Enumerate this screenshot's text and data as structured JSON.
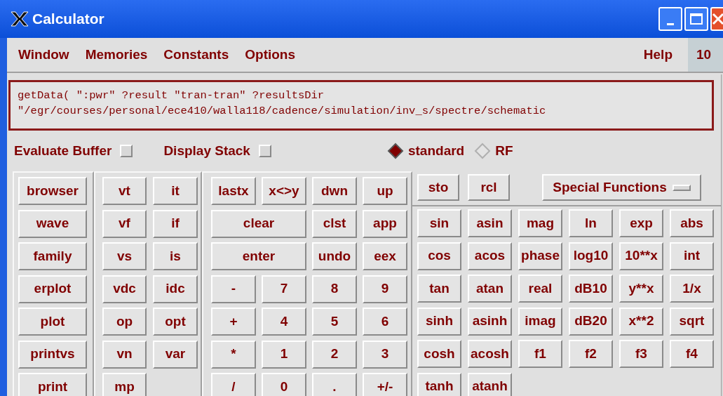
{
  "window": {
    "title": "Calculator"
  },
  "menu": {
    "items": [
      "Window",
      "Memories",
      "Constants",
      "Options"
    ],
    "help": "Help",
    "tab": "10"
  },
  "display": {
    "lines": [
      "getData( \":pwr\" ?result \"tran-tran\" ?resultsDir",
      "\"/egr/courses/personal/ece410/walla118/cadence/simulation/inv_s/spectre/schematic"
    ]
  },
  "checkboxes": [
    {
      "label": "Evaluate Buffer",
      "checked": false
    },
    {
      "label": "Display Stack",
      "checked": false
    }
  ],
  "modes": [
    {
      "label": "standard",
      "selected": true
    },
    {
      "label": "RF",
      "selected": false
    }
  ],
  "memory_buttons": [
    "sto",
    "rcl"
  ],
  "special_functions": {
    "label": "Special Functions"
  },
  "groups": [
    {
      "kind": "single",
      "buttons": [
        {
          "label": "browser"
        },
        {
          "label": "wave"
        },
        {
          "label": "family"
        },
        {
          "label": "erplot"
        },
        {
          "label": "plot"
        },
        {
          "label": "printvs"
        },
        {
          "label": "print"
        }
      ]
    },
    {
      "kind": "pair",
      "buttons": [
        {
          "label": "vt"
        },
        {
          "label": "it"
        },
        {
          "label": "vf"
        },
        {
          "label": "if"
        },
        {
          "label": "vs"
        },
        {
          "label": "is"
        },
        {
          "label": "vdc"
        },
        {
          "label": "idc"
        },
        {
          "label": "op"
        },
        {
          "label": "opt"
        },
        {
          "label": "vn"
        },
        {
          "label": "var"
        },
        {
          "label": "mp"
        }
      ]
    },
    {
      "kind": "keypad",
      "buttons": [
        {
          "label": "lastx"
        },
        {
          "label": "x<>y"
        },
        {
          "label": "dwn"
        },
        {
          "label": "up"
        },
        {
          "label": "clear",
          "wide": true
        },
        {
          "label": "clst"
        },
        {
          "label": "app"
        },
        {
          "label": "enter",
          "wide": true
        },
        {
          "label": "undo"
        },
        {
          "label": "eex"
        },
        {
          "label": "-"
        },
        {
          "label": "7"
        },
        {
          "label": "8"
        },
        {
          "label": "9"
        },
        {
          "label": "+"
        },
        {
          "label": "4"
        },
        {
          "label": "5"
        },
        {
          "label": "6"
        },
        {
          "label": "*"
        },
        {
          "label": "1"
        },
        {
          "label": "2"
        },
        {
          "label": "3"
        },
        {
          "label": "/"
        },
        {
          "label": "0"
        },
        {
          "label": "."
        },
        {
          "label": "+/-"
        }
      ]
    },
    {
      "kind": "functions",
      "buttons": [
        {
          "label": "sin"
        },
        {
          "label": "asin"
        },
        {
          "label": "mag"
        },
        {
          "label": "ln"
        },
        {
          "label": "exp"
        },
        {
          "label": "abs"
        },
        {
          "label": "cos"
        },
        {
          "label": "acos"
        },
        {
          "label": "phase"
        },
        {
          "label": "log10"
        },
        {
          "label": "10**x"
        },
        {
          "label": "int"
        },
        {
          "label": "tan"
        },
        {
          "label": "atan"
        },
        {
          "label": "real"
        },
        {
          "label": "dB10"
        },
        {
          "label": "y**x"
        },
        {
          "label": "1/x"
        },
        {
          "label": "sinh"
        },
        {
          "label": "asinh"
        },
        {
          "label": "imag"
        },
        {
          "label": "dB20"
        },
        {
          "label": "x**2"
        },
        {
          "label": "sqrt"
        },
        {
          "label": "cosh"
        },
        {
          "label": "acosh"
        },
        {
          "label": "f1"
        },
        {
          "label": "f2"
        },
        {
          "label": "f3"
        },
        {
          "label": "f4"
        },
        {
          "label": "tanh"
        },
        {
          "label": "atanh"
        }
      ]
    }
  ]
}
